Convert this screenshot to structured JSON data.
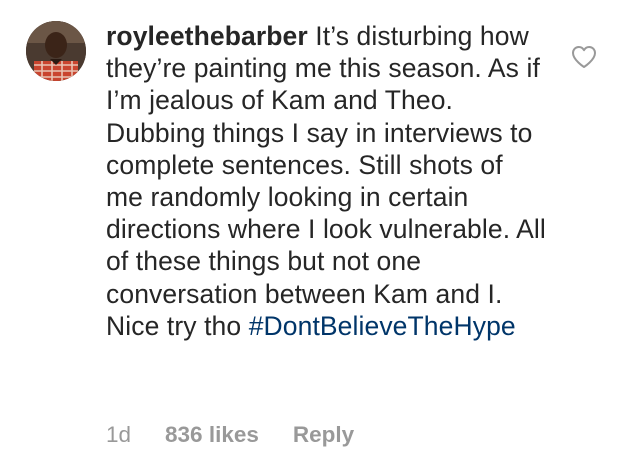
{
  "comment": {
    "username": "royleethebarber",
    "text": "It’s disturbing how they’re painting me this season. As if I’m jealous of Kam and Theo. Dubbing things I say in interviews to complete sentences. Still shots of me randomly looking in certain directions where I look vulnerable. All of these things but not one conversation between Kam and I. Nice try tho",
    "hashtag": "#DontBelieveTheHype",
    "timestamp": "1d",
    "likes": "836 likes",
    "reply_label": "Reply",
    "like_icon": "heart-outline-icon"
  },
  "colors": {
    "text": "#262626",
    "hashtag": "#003569",
    "meta": "#999999",
    "background": "#ffffff"
  }
}
